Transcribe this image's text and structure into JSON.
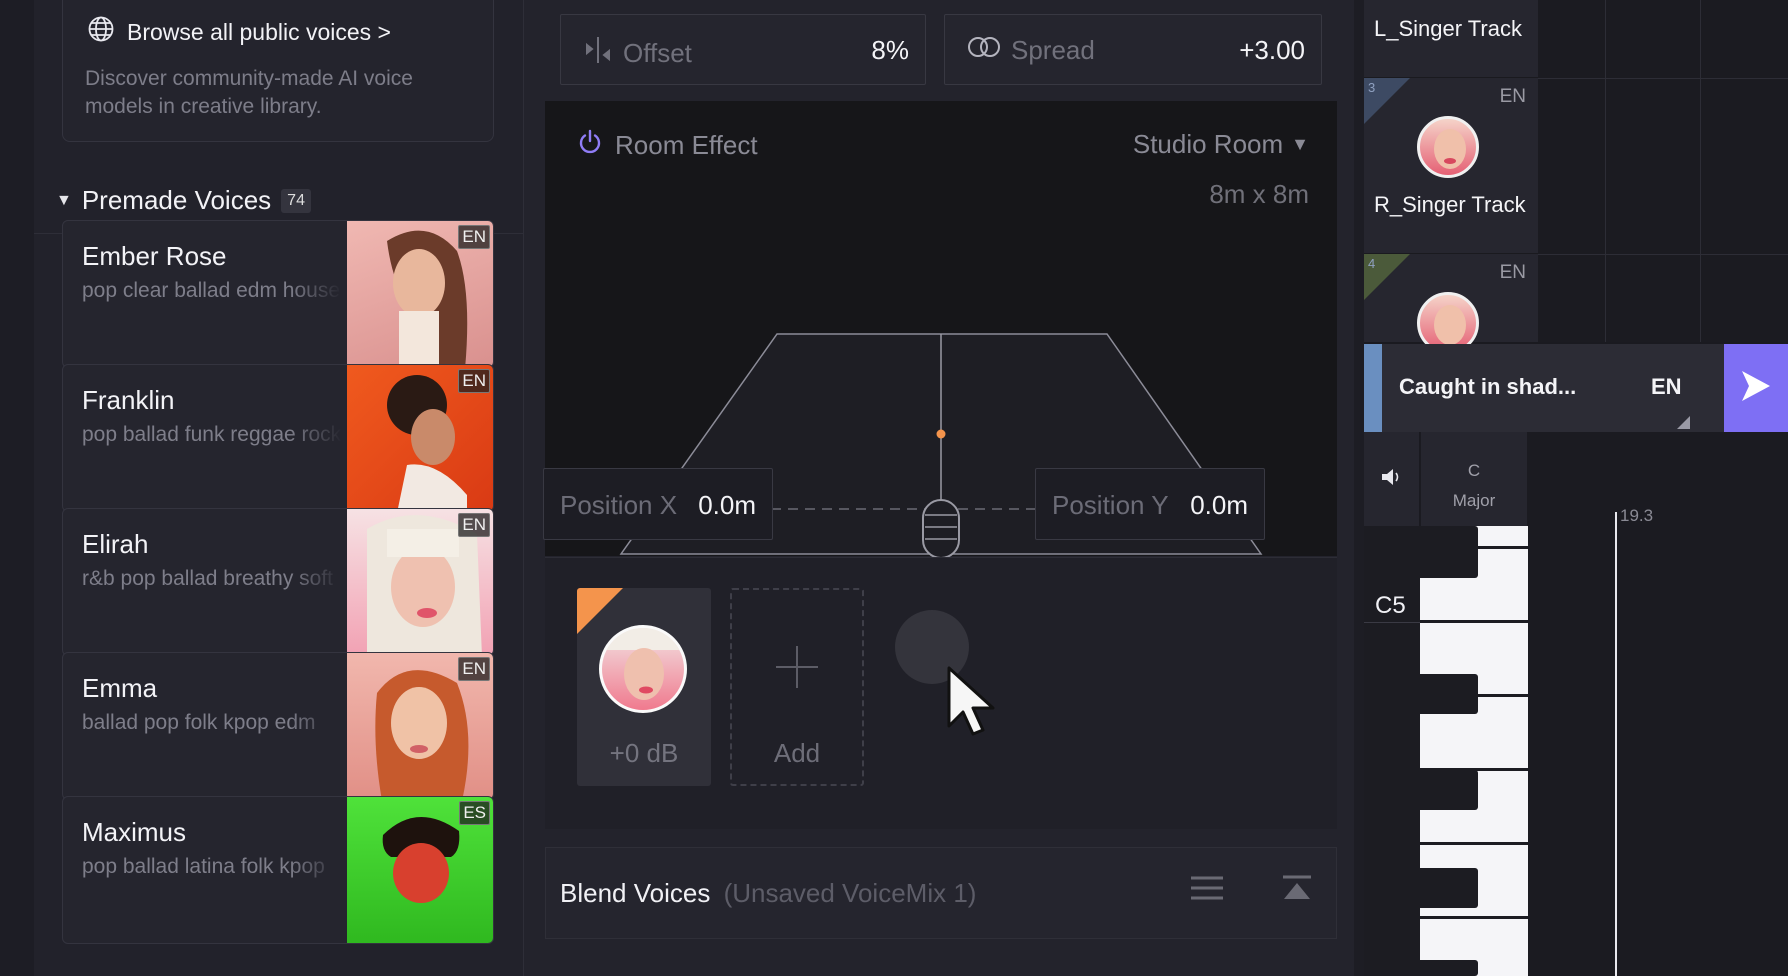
{
  "library": {
    "browse_label": "Browse all public voices >",
    "browse_desc": "Discover community-made AI voice models in creative library.",
    "premade_title": "Premade Voices",
    "premade_count": "74",
    "voices": [
      {
        "name": "Ember Rose",
        "tags": "pop clear ballad edm house",
        "lang": "EN",
        "bg": "#e8a9a5"
      },
      {
        "name": "Franklin",
        "tags": "pop ballad funk reggae rock",
        "lang": "EN",
        "bg": "#ec4a1c"
      },
      {
        "name": "Elirah",
        "tags": "r&b pop ballad breathy soft",
        "lang": "EN",
        "bg": "#f4a7b6"
      },
      {
        "name": "Emma",
        "tags": "ballad pop folk kpop edm",
        "lang": "EN",
        "bg": "#e9a49a"
      },
      {
        "name": "Maximus",
        "tags": "pop ballad latina folk kpop",
        "lang": "ES",
        "bg": "#3fd12c"
      }
    ]
  },
  "editor": {
    "offset_label": "Offset",
    "offset_value": "8%",
    "spread_label": "Spread",
    "spread_value": "+3.00",
    "room_label": "Room Effect",
    "room_preset": "Studio Room",
    "room_size": "8m x 8m",
    "position_x_label": "Position X",
    "position_x_value": "0.0m",
    "position_y_label": "Position Y",
    "position_y_value": "0.0m",
    "slot_gain": "+0 dB",
    "add_label": "Add",
    "blend_title": "Blend Voices",
    "blend_subtitle": "(Unsaved VoiceMix 1)"
  },
  "tracks": {
    "items": [
      {
        "name": "L_Singer Track"
      },
      {
        "number": "3",
        "lang": "EN",
        "name": "R_Singer Track"
      },
      {
        "number": "4",
        "lang": "EN"
      }
    ],
    "song_title": "Caught in shad...",
    "song_lang": "EN",
    "key_root": "C",
    "key_mode": "Major",
    "ruler_marker": "19.3",
    "note_label": "C5"
  },
  "colors": {
    "accent_purple": "#7e6ff4",
    "room_power": "#8f7cf6",
    "slot_corner": "#f4944c",
    "track_accent": "#6a8fc0"
  },
  "icons": {
    "globe": "globe-icon",
    "offset": "offset-icon",
    "spread": "spread-icon",
    "power": "power-icon",
    "dropdown": "caret-down-icon",
    "microphone": "microphone-icon",
    "plus": "plus-icon",
    "menu": "list-icon",
    "collapse": "collapse-top-icon",
    "play": "play-icon",
    "speaker": "speaker-icon"
  }
}
